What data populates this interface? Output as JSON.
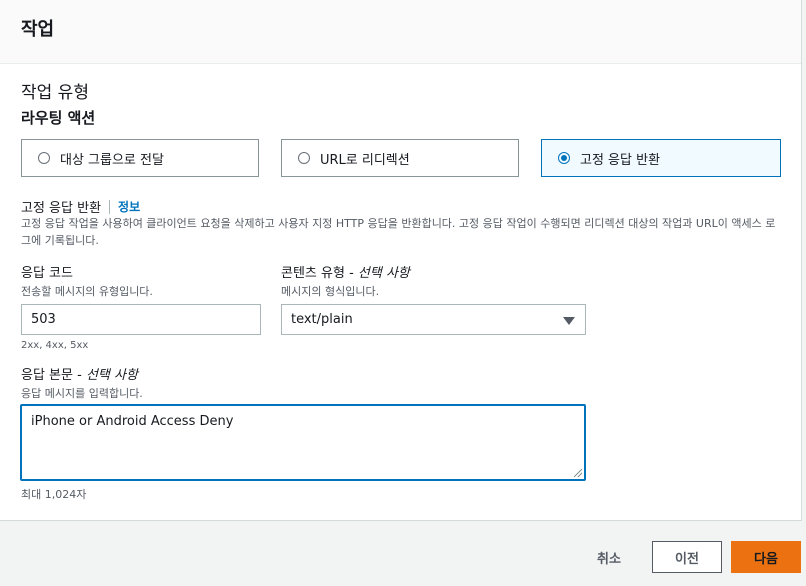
{
  "panel": {
    "title": "작업"
  },
  "action_type": {
    "section_label": "작업 유형",
    "routing_label": "라우팅 액션",
    "options": [
      {
        "label": "대상 그룹으로 전달",
        "selected": false
      },
      {
        "label": "URL로 리디렉션",
        "selected": false
      },
      {
        "label": "고정 응답 반환",
        "selected": true
      }
    ]
  },
  "fixed_response": {
    "title": "고정 응답 반환",
    "info_link": "정보",
    "description": "고정 응답 작업을 사용하여 클라이언트 요청을 삭제하고 사용자 지정 HTTP 응답을 반환합니다. 고정 응답 작업이 수행되면 리디렉션 대상의 작업과 URL이 액세스 로그에 기록됩니다."
  },
  "response_code": {
    "label": "응답 코드",
    "hint": "전송할 메시지의 유형입니다.",
    "value": "503",
    "constraint": "2xx, 4xx, 5xx"
  },
  "content_type": {
    "label": "콘텐츠 유형 - ",
    "optional": "선택 사항",
    "hint": "메시지의 형식입니다.",
    "value": "text/plain"
  },
  "response_body": {
    "label": "응답 본문 - ",
    "optional": "선택 사항",
    "hint": "응답 메시지를 입력합니다.",
    "value": "iPhone or Android Access Deny",
    "constraint": "최대 1,024자"
  },
  "footer": {
    "cancel": "취소",
    "previous": "이전",
    "next": "다음"
  },
  "colors": {
    "accent": "#0073bb",
    "primary_button": "#ec7211"
  }
}
